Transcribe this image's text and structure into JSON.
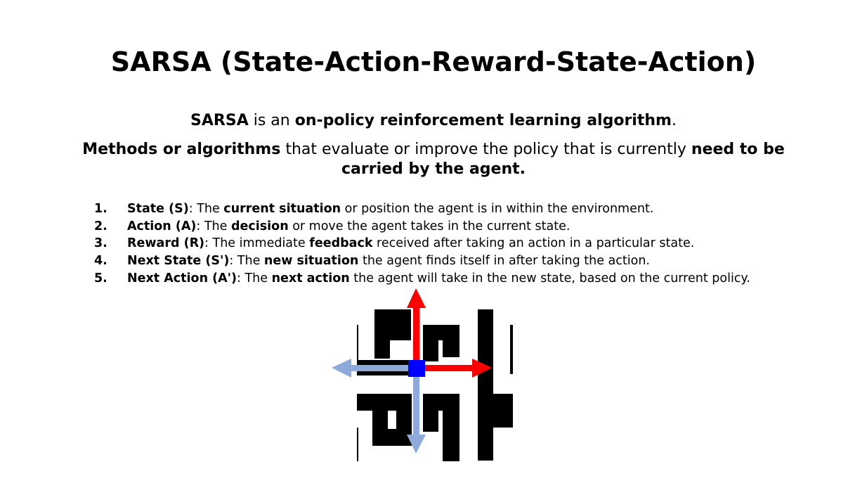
{
  "slide": {
    "title": "SARSA (State-Action-Reward-State-Action)",
    "intro": {
      "term": "SARSA",
      "text1": " is an ",
      "bold1": "on-policy reinforcement learning algorithm",
      "end": "."
    },
    "intro2": {
      "bold1": "Methods or algorithms",
      "text1": " that evaluate or improve the policy that is currently ",
      "bold2": "need to be carried by the agent."
    },
    "steps": [
      {
        "num": "1.",
        "term": "State (S)",
        "t1": ": The ",
        "b": "current situation",
        "t2": " or position the agent is in within the environment."
      },
      {
        "num": "2.",
        "term": "Action (A)",
        "t1": ": The ",
        "b": "decision",
        "t2": " or move the agent takes in the current state."
      },
      {
        "num": "3.",
        "term": "Reward (R)",
        "t1": ": The immediate ",
        "b": "feedback",
        "t2": " received after taking an action in a particular state."
      },
      {
        "num": "4.",
        "term": "Next State (S')",
        "t1": ": The ",
        "b": "new situation",
        "t2": " the agent finds itself in after taking the action."
      },
      {
        "num": "5.",
        "term": "Next Action (A')",
        "t1": ": The ",
        "b": "next action",
        "t2": " the agent will take in the new state, based on the current policy."
      }
    ]
  },
  "colors": {
    "maze_wall": "#000000",
    "agent": "#0000ff",
    "current_action_arrow": "#ff0000",
    "next_action_arrow": "#8eaadb"
  }
}
